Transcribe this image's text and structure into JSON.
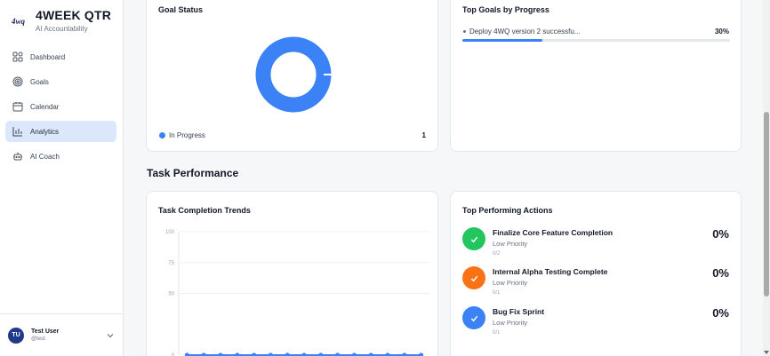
{
  "brand": {
    "title": "4WEEK QTR",
    "subtitle": "AI Accountability",
    "logo_text": "4wq"
  },
  "nav": {
    "items": [
      {
        "label": "Dashboard",
        "icon": "dashboard-icon"
      },
      {
        "label": "Goals",
        "icon": "target-icon"
      },
      {
        "label": "Calendar",
        "icon": "calendar-icon"
      },
      {
        "label": "Analytics",
        "icon": "analytics-icon",
        "active": true
      },
      {
        "label": "AI Coach",
        "icon": "bot-icon"
      }
    ]
  },
  "user": {
    "initials": "TU",
    "name": "Test User",
    "handle": "@test"
  },
  "goal_status": {
    "title": "Goal Status",
    "legend": [
      {
        "label": "In Progress",
        "count": "1",
        "color": "#3b82f6"
      }
    ]
  },
  "top_goals": {
    "title": "Top Goals by Progress",
    "items": [
      {
        "name": "Deploy 4WQ version 2 successfu...",
        "percent_label": "30%",
        "progress": 0.3
      }
    ]
  },
  "section": {
    "task_performance": "Task Performance"
  },
  "chart_data": {
    "type": "line",
    "title": "Task Completion Trends",
    "yticks": [
      "100",
      "75",
      "50",
      "0"
    ],
    "ylim": [
      0,
      100
    ],
    "grid": true,
    "series": [
      {
        "values": [
          0,
          0,
          0,
          0,
          0,
          0,
          0,
          0,
          0,
          0,
          0,
          0,
          0,
          0,
          0
        ],
        "color": "#3b82f6"
      }
    ]
  },
  "top_actions": {
    "title": "Top Performing Actions",
    "items": [
      {
        "title": "Finalize Core Feature Completion",
        "priority": "Low Priority",
        "count": "0/2",
        "percent": "0%",
        "color": "#22c55e"
      },
      {
        "title": "Internal Alpha Testing Complete",
        "priority": "Low Priority",
        "count": "0/1",
        "percent": "0%",
        "color": "#f97316"
      },
      {
        "title": "Bug Fix Sprint",
        "priority": "Low Priority",
        "count": "0/1",
        "percent": "0%",
        "color": "#3b82f6"
      }
    ]
  },
  "colors": {
    "accent": "#3b82f6",
    "active_nav_bg": "#dbe7fb",
    "avatar_bg": "#1e3a8a"
  }
}
